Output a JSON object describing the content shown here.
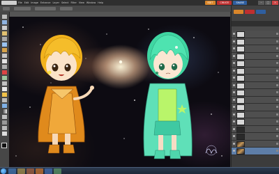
{
  "app": {
    "menu": [
      "File",
      "Edit",
      "Image",
      "Enhance",
      "Layer",
      "Select",
      "Filter",
      "View",
      "Window",
      "Help"
    ],
    "document_tab": "Chibi brothers @ 66.7% (Layer 2, RGB/8) *",
    "mode_tabs": [
      "EDIT",
      "CREATE",
      "SHARE"
    ],
    "window_controls": [
      "–",
      "□",
      "×"
    ]
  },
  "panel": {
    "title": "LAYERS",
    "layers": [
      {
        "name": "",
        "thumb": "light"
      },
      {
        "name": "",
        "thumb": "light"
      },
      {
        "name": "",
        "thumb": "light"
      },
      {
        "name": "",
        "thumb": "light"
      },
      {
        "name": "",
        "thumb": "light"
      },
      {
        "name": "",
        "thumb": "light"
      },
      {
        "name": "",
        "thumb": "light"
      },
      {
        "name": "",
        "thumb": "light"
      },
      {
        "name": "",
        "thumb": "light"
      },
      {
        "name": "",
        "thumb": "light"
      },
      {
        "name": "",
        "thumb": "light"
      },
      {
        "name": "",
        "thumb": "light"
      },
      {
        "name": "",
        "thumb": "light"
      },
      {
        "name": "",
        "thumb": "dark"
      },
      {
        "name": "",
        "thumb": "dark"
      },
      {
        "name": "",
        "thumb": "photo"
      },
      {
        "name": "",
        "thumb": "photo",
        "active": true
      }
    ]
  },
  "taskbar": {
    "time": "",
    "date": ""
  },
  "colors": {
    "edit_tab": "#d9862a",
    "create_tab": "#bf2f2f",
    "share_tab": "#2f5fa0",
    "active_layer": "#5e7ea8"
  },
  "icons": [
    "windows-start-icon",
    "ie-icon",
    "explorer-icon",
    "media-icon",
    "firefox-icon",
    "photoshop-icon",
    "chat-icon"
  ]
}
